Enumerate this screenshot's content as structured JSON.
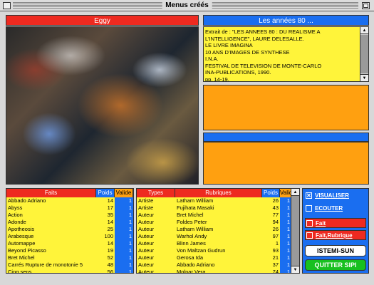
{
  "window": {
    "title": "Menus créés"
  },
  "image_panel": {
    "title": "Eggy"
  },
  "text_panel": {
    "title": "Les années 80 ...",
    "lines": [
      "Extrait de : \"LES ANNEES 80 : DU REALISME A",
      "L'INTELLIGENCE\", LAURE DELESALLE.",
      "LE LIVRE IMAGINA",
      "10 ANS D'IMAGES DE SYNTHESE",
      "I.N.A.",
      "FESTIVAL DE TELEVISION DE MONTE-CARLO",
      "INA-PUBLICATIONS, 1990.",
      "pp. 14-19."
    ]
  },
  "faits_list": {
    "headers": {
      "name": "Faits",
      "weight": "Poids",
      "valid": "Valide"
    },
    "rows": [
      {
        "name": "Abbado Adriano",
        "weight": "14",
        "valid": "1"
      },
      {
        "name": "Abyss",
        "weight": "17",
        "valid": "1"
      },
      {
        "name": "Action",
        "weight": "35",
        "valid": "1"
      },
      {
        "name": "Adonde",
        "weight": "14",
        "valid": "1"
      },
      {
        "name": "Apotheosis",
        "weight": "25",
        "valid": "1"
      },
      {
        "name": "Arabesque",
        "weight": "100",
        "valid": "1"
      },
      {
        "name": "Automappe",
        "weight": "14",
        "valid": "1"
      },
      {
        "name": "Beyond Picasso",
        "weight": "19",
        "valid": "1"
      },
      {
        "name": "Bret Michel",
        "weight": "52",
        "valid": "1"
      },
      {
        "name": "Carrés Rupture de monotonie 5",
        "weight": "48",
        "valid": "1"
      },
      {
        "name": "Cinq sens",
        "weight": "56",
        "valid": "1"
      }
    ]
  },
  "rubriques_list": {
    "headers": {
      "type": "Types",
      "name": "Rubriques",
      "weight": "Poids",
      "valid": "Valide"
    },
    "rows": [
      {
        "type": "Artiste",
        "name": "Latham William",
        "weight": "26",
        "valid": "1"
      },
      {
        "type": "Artiste",
        "name": "Fujihata Masaki",
        "weight": "43",
        "valid": "1"
      },
      {
        "type": "Auteur",
        "name": "Bret Michel",
        "weight": "77",
        "valid": "1"
      },
      {
        "type": "Auteur",
        "name": "Foldes Peter",
        "weight": "94",
        "valid": "1"
      },
      {
        "type": "Auteur",
        "name": "Latham William",
        "weight": "26",
        "valid": "1"
      },
      {
        "type": "Auteur",
        "name": "Warhol Andy",
        "weight": "97",
        "valid": "1"
      },
      {
        "type": "Auteur",
        "name": "Blinn James",
        "weight": "1",
        "valid": "1"
      },
      {
        "type": "Auteur",
        "name": "Von Maltzan Gudrun",
        "weight": "93",
        "valid": "1"
      },
      {
        "type": "Auteur",
        "name": "Gerosa Ida",
        "weight": "21",
        "valid": "1"
      },
      {
        "type": "Auteur",
        "name": "Abbado Adriano",
        "weight": "37",
        "valid": "1"
      },
      {
        "type": "Auteur",
        "name": "Molnar Vera",
        "weight": "74",
        "valid": "1"
      }
    ]
  },
  "controls": {
    "visualiser": {
      "label": "VISUALISER",
      "checked": true,
      "mark": "✕"
    },
    "ecouter": {
      "label": "ECOUTER",
      "checked": false
    },
    "fait": {
      "label": "Fait",
      "checked": false
    },
    "fait_rubrique": {
      "label": "Fait,Rubrique",
      "checked": false
    },
    "istemi_button": "ISTEMI-SUN",
    "quit_button": "QUITTER SIPI"
  },
  "colors": {
    "red": "#ee2a20",
    "blue": "#1a6ef0",
    "yellow": "#fff43a",
    "orange": "#ffa010",
    "green": "#18c020"
  },
  "icons": {
    "scroll_up": "▲",
    "scroll_down": "▼"
  }
}
